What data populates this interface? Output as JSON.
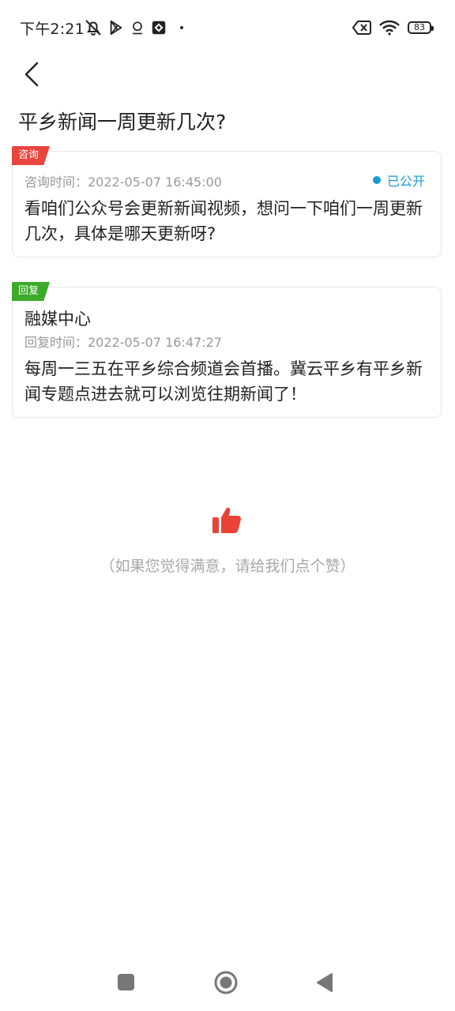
{
  "status_bar": {
    "time": "下午2:21",
    "battery": "83"
  },
  "page": {
    "title": "平乡新闻一周更新几次?"
  },
  "question": {
    "tag": "咨询",
    "time_label": "咨询时间：2022-05-07 16:45:00",
    "status": "已公开",
    "content": "看咱们公众号会更新新闻视频，想问一下咱们一周更新几次，具体是哪天更新呀?"
  },
  "reply": {
    "tag": "回复",
    "author": "融媒中心",
    "time_label": "回复时间：2022-05-07 16:47:27",
    "content": "每周一三五在平乡综合频道会首播。冀云平乡有平乡新闻专题点进去就可以浏览往期新闻了！"
  },
  "feedback": {
    "hint": "（如果您觉得满意，请给我们点个赞）"
  },
  "colors": {
    "question_tag": "#e8453c",
    "reply_tag": "#3cab2a",
    "public_status": "#1a9ad6",
    "like": "#ea4335"
  },
  "icons": {
    "back": "chevron-left-icon",
    "like": "thumbs-up-icon"
  }
}
